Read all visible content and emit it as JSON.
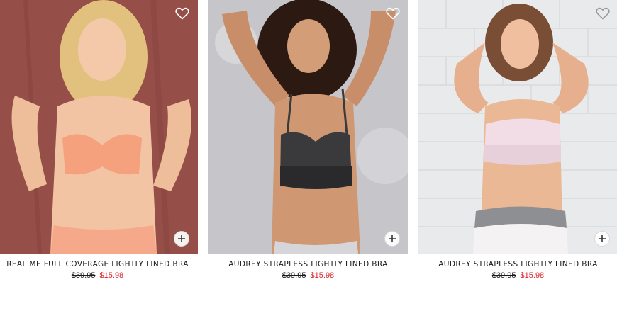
{
  "colors": {
    "sale_price": "#d9242b",
    "heart_outline": "#ffffff",
    "add_button_bg": "#ffffff"
  },
  "products": [
    {
      "name": "REAL ME FULL COVERAGE LIGHTLY LINED BRA",
      "original_price": "$39.95",
      "sale_price": "$15.98",
      "favorite_icon": "heart-outline-icon",
      "add_icon": "plus-circle-icon"
    },
    {
      "name": "AUDREY STRAPLESS LIGHTLY LINED BRA",
      "original_price": "$39.95",
      "sale_price": "$15.98",
      "favorite_icon": "heart-outline-icon",
      "add_icon": "plus-circle-icon"
    },
    {
      "name": "AUDREY STRAPLESS LIGHTLY LINED BRA",
      "original_price": "$39.95",
      "sale_price": "$15.98",
      "favorite_icon": "heart-outline-icon",
      "add_icon": "plus-circle-icon"
    }
  ]
}
